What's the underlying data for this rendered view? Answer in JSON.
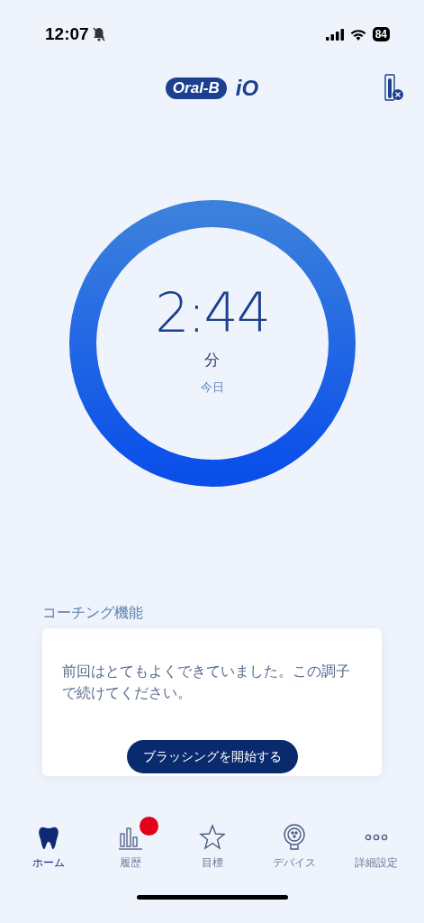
{
  "status_bar": {
    "time": "12:07",
    "silent": true,
    "battery": "84"
  },
  "header": {
    "logo": "Oral-B",
    "logo_suffix": "iO"
  },
  "timer": {
    "value": "2:44",
    "unit": "分",
    "period": "今日"
  },
  "coaching": {
    "title": "コーチング機能",
    "message": "前回はとてもよくできていました。この調子で続けてください。",
    "button": "ブラッシングを開始する"
  },
  "tabs": [
    {
      "kind": "home",
      "label": "ホーム",
      "selected": true,
      "badge": false
    },
    {
      "kind": "history",
      "label": "履歴",
      "selected": false,
      "badge": true
    },
    {
      "kind": "goals",
      "label": "目標",
      "selected": false,
      "badge": false
    },
    {
      "kind": "device",
      "label": "デバイス",
      "selected": false,
      "badge": false
    },
    {
      "kind": "more",
      "label": "詳細設定",
      "selected": false,
      "badge": false
    }
  ]
}
